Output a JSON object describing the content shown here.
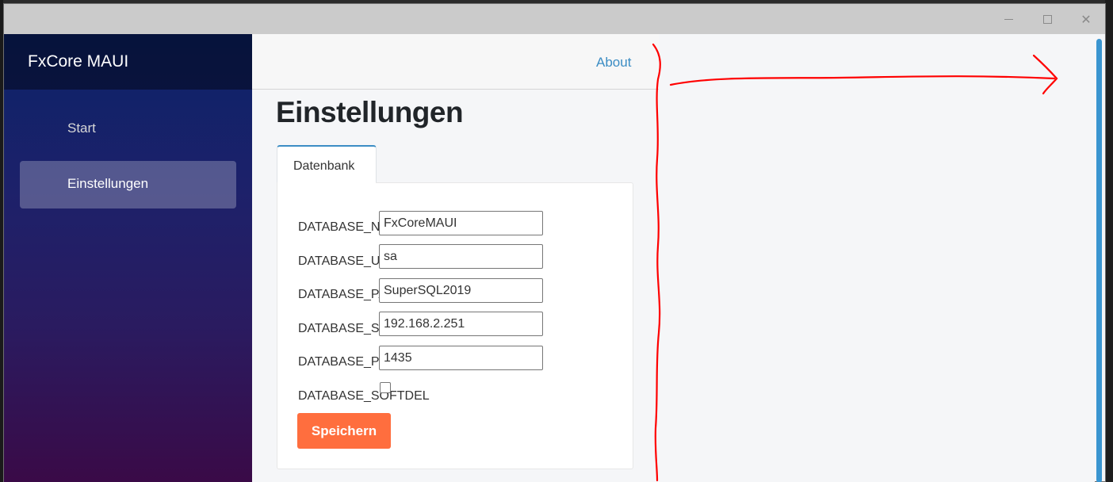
{
  "window": {
    "minimize_icon": "minimize-icon",
    "maximize_icon": "maximize-icon",
    "close_icon": "close-icon"
  },
  "sidebar": {
    "brand": "FxCore MAUI",
    "items": [
      {
        "label": "Start"
      },
      {
        "label": "Einstellungen",
        "active": true
      }
    ]
  },
  "topbar": {
    "about": "About"
  },
  "page": {
    "title": "Einstellungen",
    "tab": "Datenbank",
    "fields": [
      {
        "label": "DATABASE_NAME",
        "value": "FxCoreMAUI"
      },
      {
        "label": "DATABASE_USER",
        "value": "sa"
      },
      {
        "label": "DATABASE_PASSWORD",
        "value": "SuperSQL2019"
      },
      {
        "label": "DATABASE_SERVER",
        "value": "192.168.2.251"
      },
      {
        "label": "DATABASE_PORT",
        "value": "1435"
      }
    ],
    "checkbox_field": {
      "label": "DATABASE_SOFTDEL",
      "checked": false
    },
    "save_label": "Speichern"
  },
  "colors": {
    "accent": "#3c8dc4",
    "save_button": "#ff6e3e",
    "annotation": "#ff0000"
  }
}
